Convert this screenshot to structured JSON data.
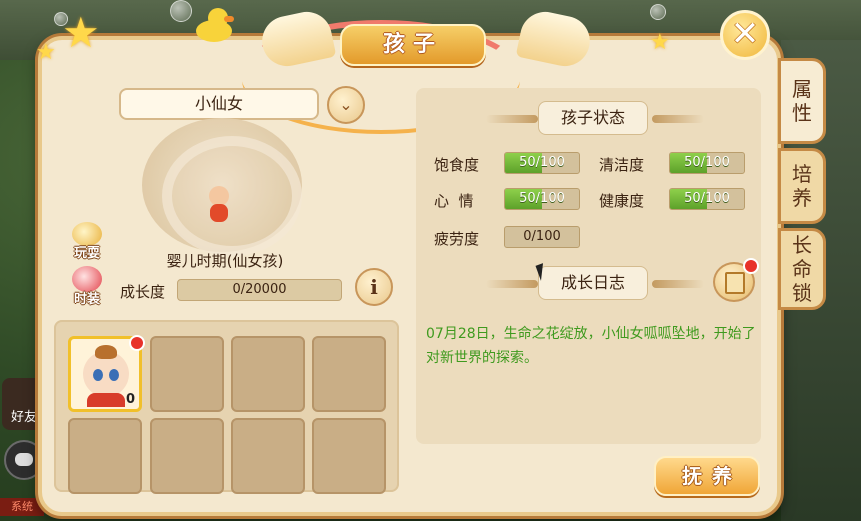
{
  "window": {
    "title": "孩子"
  },
  "side_tabs": [
    {
      "label_top": "属",
      "label_bottom": "性"
    },
    {
      "label_top": "培",
      "label_bottom": "养"
    },
    {
      "label_top": "长",
      "label_mid": "命",
      "label_bottom": "锁"
    }
  ],
  "child": {
    "name": "小仙女",
    "stage": "婴儿时期(仙女孩)",
    "growth_label": "成长度",
    "growth_value": "0/20000",
    "growth_fraction": 0
  },
  "side_icons": {
    "play": "玩耍",
    "fashion": "时装"
  },
  "status": {
    "title": "孩子状态",
    "stats": [
      {
        "label": "饱食度",
        "value": "50/100",
        "fraction": 0.5
      },
      {
        "label": "清洁度",
        "value": "50/100",
        "fraction": 0.5
      },
      {
        "label": "心  情",
        "value": "50/100",
        "fraction": 0.5
      },
      {
        "label": "健康度",
        "value": "50/100",
        "fraction": 0.5
      },
      {
        "label": "疲劳度",
        "value": "0/100",
        "fraction": 0
      }
    ]
  },
  "log": {
    "title": "成长日志",
    "entry": "07月28日，生命之花绽放，小仙女呱呱坠地，开始了对新世界的探索。"
  },
  "slots": {
    "first_count": "0"
  },
  "buttons": {
    "foster": "抚养",
    "close": "✕",
    "dropdown": "⌄",
    "info": "i"
  },
  "overlay": {
    "friend": "好友",
    "system": "系统"
  },
  "colors": {
    "accent": "#f0a637",
    "stat_fill": "#6cb232",
    "log_text": "#3f9a1e"
  }
}
